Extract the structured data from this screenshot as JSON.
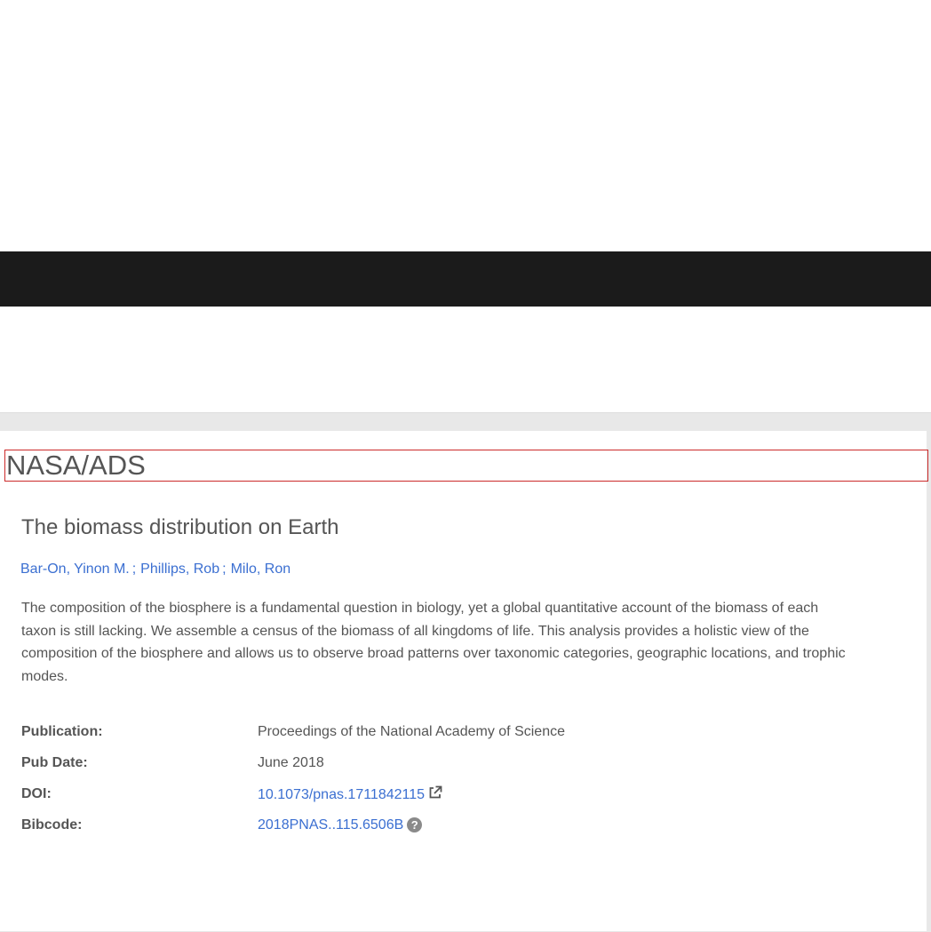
{
  "header": {
    "brand": "NASA/ADS"
  },
  "article": {
    "title": "The biomass distribution on Earth",
    "authors": [
      {
        "name": "Bar-On, Yinon M."
      },
      {
        "name": "Phillips, Rob"
      },
      {
        "name": "Milo, Ron"
      }
    ],
    "author_separator": ";",
    "abstract": "The composition of the biosphere is a fundamental question in biology, yet a global quantitative account of the biomass of each taxon is still lacking. We assemble a census of the biomass of all kingdoms of life. This analysis provides a holistic view of the composition of the biosphere and allows us to observe broad patterns over taxonomic categories, geographic locations, and trophic modes."
  },
  "metadata": {
    "publication": {
      "label": "Publication:",
      "value": "Proceedings of the National Academy of Science"
    },
    "pub_date": {
      "label": "Pub Date:",
      "value": "June 2018"
    },
    "doi": {
      "label": "DOI:",
      "value": "10.1073/pnas.1711842115",
      "icon": "external-link-icon"
    },
    "bibcode": {
      "label": "Bibcode:",
      "value": "2018PNAS..115.6506B",
      "icon": "help-icon",
      "icon_glyph": "?"
    }
  },
  "colors": {
    "link": "#3b6fd1",
    "dark_bar": "#1b1b1b",
    "frame": "#e8e8e8",
    "highlight_border": "#cc2a2a"
  }
}
